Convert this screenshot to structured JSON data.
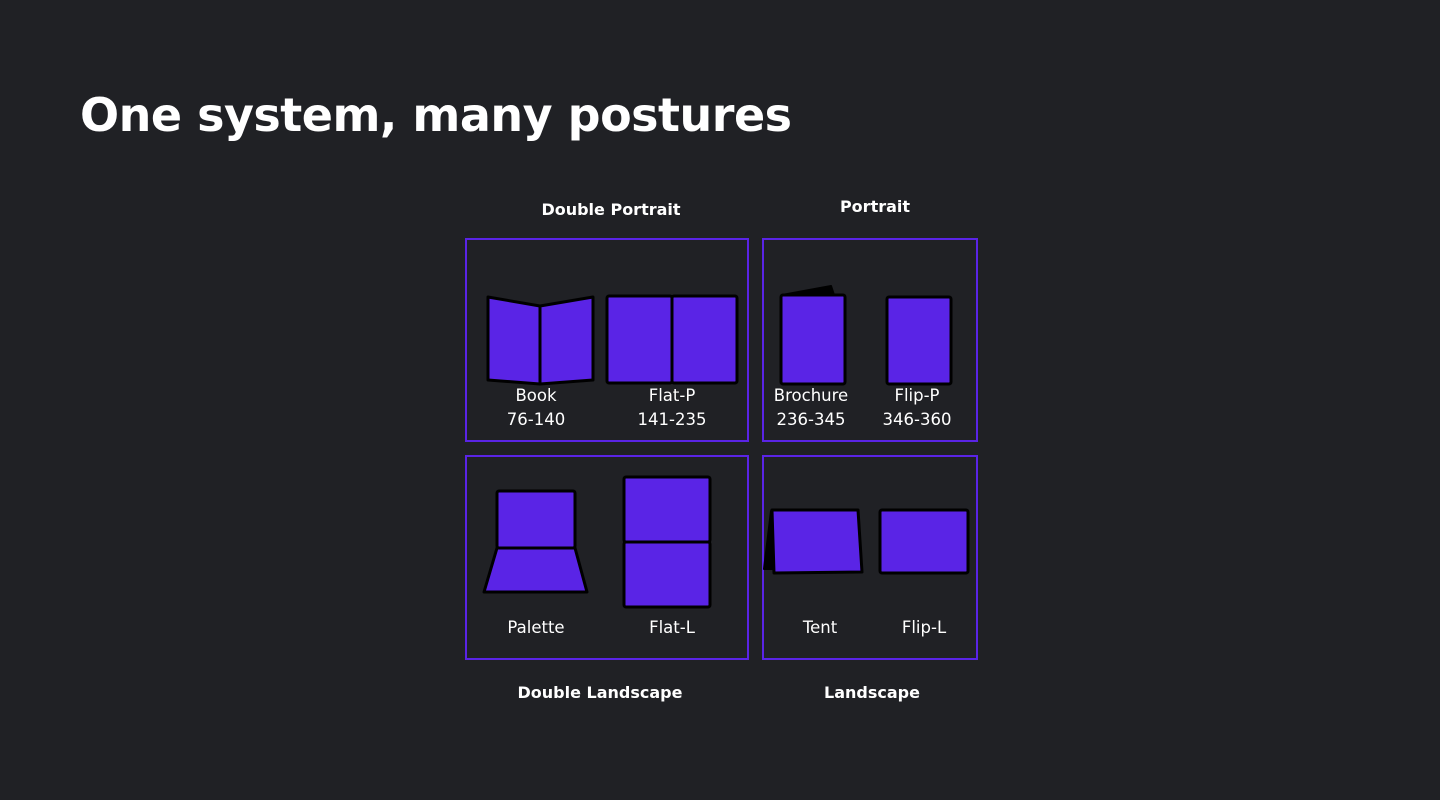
{
  "title": "One system, many postures",
  "colors": {
    "background": "#202125",
    "accent": "#5a24e6",
    "outline": "#000000",
    "text": "#ffffff"
  },
  "groups": [
    {
      "label": "Double Portrait",
      "postures": [
        {
          "name": "Book",
          "range": "76-140",
          "icon": "book-posture-icon"
        },
        {
          "name": "Flat-P",
          "range": "141-235",
          "icon": "flat-portrait-posture-icon"
        }
      ]
    },
    {
      "label": "Portrait",
      "postures": [
        {
          "name": "Brochure",
          "range": "236-345",
          "icon": "brochure-posture-icon"
        },
        {
          "name": "Flip-P",
          "range": "346-360",
          "icon": "flip-portrait-posture-icon"
        }
      ]
    },
    {
      "label": "Double Landscape",
      "postures": [
        {
          "name": "Palette",
          "icon": "palette-posture-icon"
        },
        {
          "name": "Flat-L",
          "icon": "flat-landscape-posture-icon"
        }
      ]
    },
    {
      "label": "Landscape",
      "postures": [
        {
          "name": "Tent",
          "icon": "tent-posture-icon"
        },
        {
          "name": "Flip-L",
          "icon": "flip-landscape-posture-icon"
        }
      ]
    }
  ]
}
